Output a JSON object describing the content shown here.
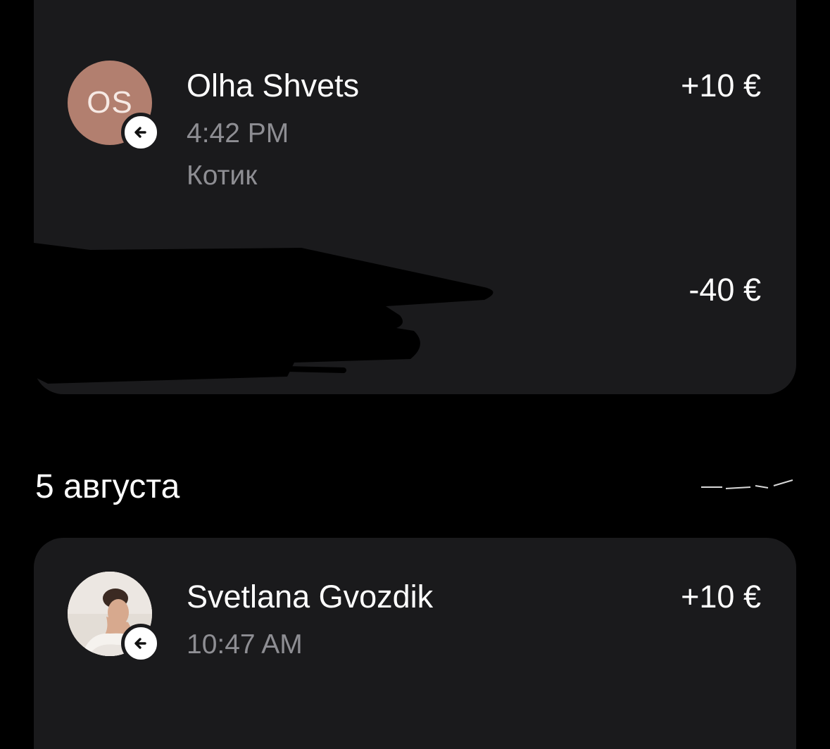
{
  "transactions_group_1": {
    "items": [
      {
        "avatar_initials": "OS",
        "avatar_color": "#b27f6f",
        "direction_icon": "arrow-left-icon",
        "name": "Olha Shvets",
        "time": "4:42 PM",
        "note": "Котик",
        "amount": "+10 €"
      },
      {
        "amount": "-40 €"
      }
    ]
  },
  "section": {
    "date_heading": "5 августа"
  },
  "transactions_group_2": {
    "items": [
      {
        "direction_icon": "arrow-left-icon",
        "name": "Svetlana Gvozdik",
        "time": "10:47 AM",
        "amount": "+10 €"
      }
    ]
  },
  "colors": {
    "background": "#000000",
    "card": "#1a1a1c",
    "secondary_text": "#8e8e93"
  }
}
